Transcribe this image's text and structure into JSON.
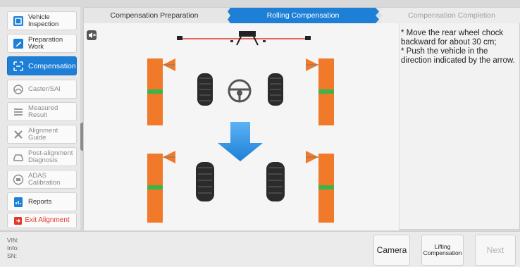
{
  "sidebar": {
    "items": [
      {
        "label": "Vehicle\nInspection",
        "icon": "vehicle-inspection-icon",
        "state": "normal"
      },
      {
        "label": "Preparation\nWork",
        "icon": "preparation-icon",
        "state": "normal"
      },
      {
        "label": "Compensation",
        "icon": "compensation-icon",
        "state": "active"
      },
      {
        "label": "Caster/SAI",
        "icon": "caster-icon",
        "state": "disabled"
      },
      {
        "label": "Measured\nResult",
        "icon": "measured-result-icon",
        "state": "disabled"
      },
      {
        "label": "Alignment\nGuide",
        "icon": "alignment-guide-icon",
        "state": "disabled"
      },
      {
        "label": "Post-alignment\nDiagnosis",
        "icon": "post-alignment-icon",
        "state": "disabled"
      },
      {
        "label": "ADAS\nCalibration",
        "icon": "adas-icon",
        "state": "disabled"
      },
      {
        "label": "Reports",
        "icon": "reports-icon",
        "state": "normal"
      }
    ],
    "exit_label": "Exit Alignment"
  },
  "steps": [
    {
      "label": "Compensation Preparation",
      "state": "done"
    },
    {
      "label": "Rolling Compensation",
      "state": "active"
    },
    {
      "label": "Compensation Completion",
      "state": "pending"
    }
  ],
  "instructions": [
    "* Move the rear wheel chock backward for about 30 cm;",
    "* Push the vehicle in the direction indicated by the arrow."
  ],
  "info": {
    "vin_label": "VIN:",
    "info_label": "Info:",
    "sn_label": "SN:"
  },
  "buttons": {
    "camera": "Camera",
    "lifting": "Lifting\nCompensation",
    "next": "Next"
  },
  "colors": {
    "accent": "#1e7fd6",
    "target_orange": "#f07a2a",
    "target_green": "#3ab54a",
    "arrow_blue": "#2f8fe8",
    "exit_red": "#e23a2a"
  }
}
